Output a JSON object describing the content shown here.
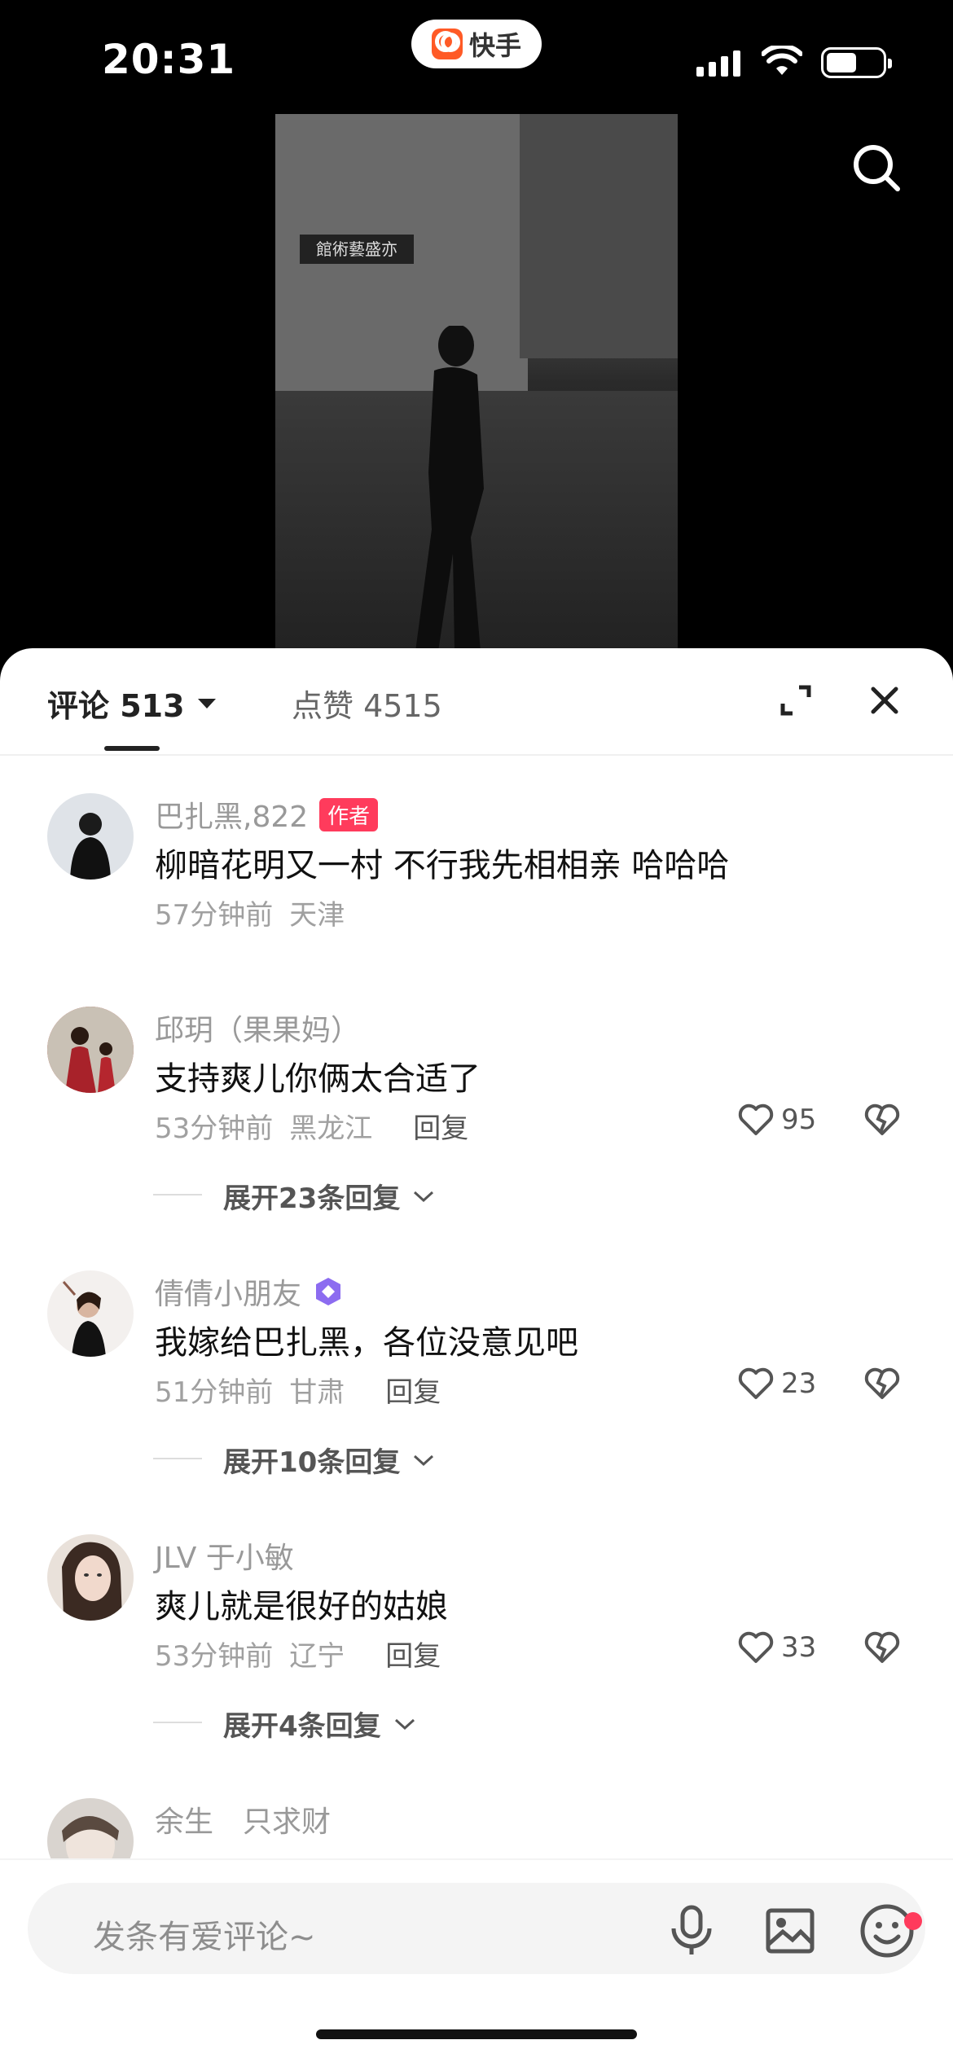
{
  "status_bar": {
    "time": "20:31",
    "app_name": "快手"
  },
  "video": {
    "sign_text": "館術藝盛亦"
  },
  "tabs": {
    "comments_label": "评论 513",
    "likes_label": "点赞 4515"
  },
  "comments": [
    {
      "username": "巴扎黑,822",
      "badge": "作者",
      "text": "柳暗花明又一村 不行我先相相亲 哈哈哈",
      "time": "57分钟前",
      "location": "天津"
    },
    {
      "username": "邱玥（果果妈）",
      "text": "支持爽儿你俩太合适了",
      "time": "53分钟前",
      "location": "黑龙江",
      "reply_label": "回复",
      "likes": "95",
      "expand_label": "展开23条回复"
    },
    {
      "username": "倩倩小朋友",
      "text": "我嫁给巴扎黑，各位没意见吧",
      "time": "51分钟前",
      "location": "甘肃",
      "reply_label": "回复",
      "likes": "23",
      "expand_label": "展开10条回复"
    },
    {
      "username": "JLV 于小敏",
      "text": "爽儿就是很好的姑娘",
      "time": "53分钟前",
      "location": "辽宁",
      "reply_label": "回复",
      "likes": "33",
      "expand_label": "展开4条回复"
    },
    {
      "username": "余生　只求财"
    }
  ],
  "input": {
    "placeholder": "发条有爱评论~"
  },
  "icons": {
    "search": "search-icon",
    "expand": "expand-icon",
    "close": "close-icon",
    "like": "heart-icon",
    "dislike": "broken-heart-icon",
    "mic": "mic-icon",
    "image": "image-icon",
    "emoji": "emoji-icon"
  },
  "colors": {
    "accent": "#ff3b5c",
    "brand": "#ff5a26"
  }
}
